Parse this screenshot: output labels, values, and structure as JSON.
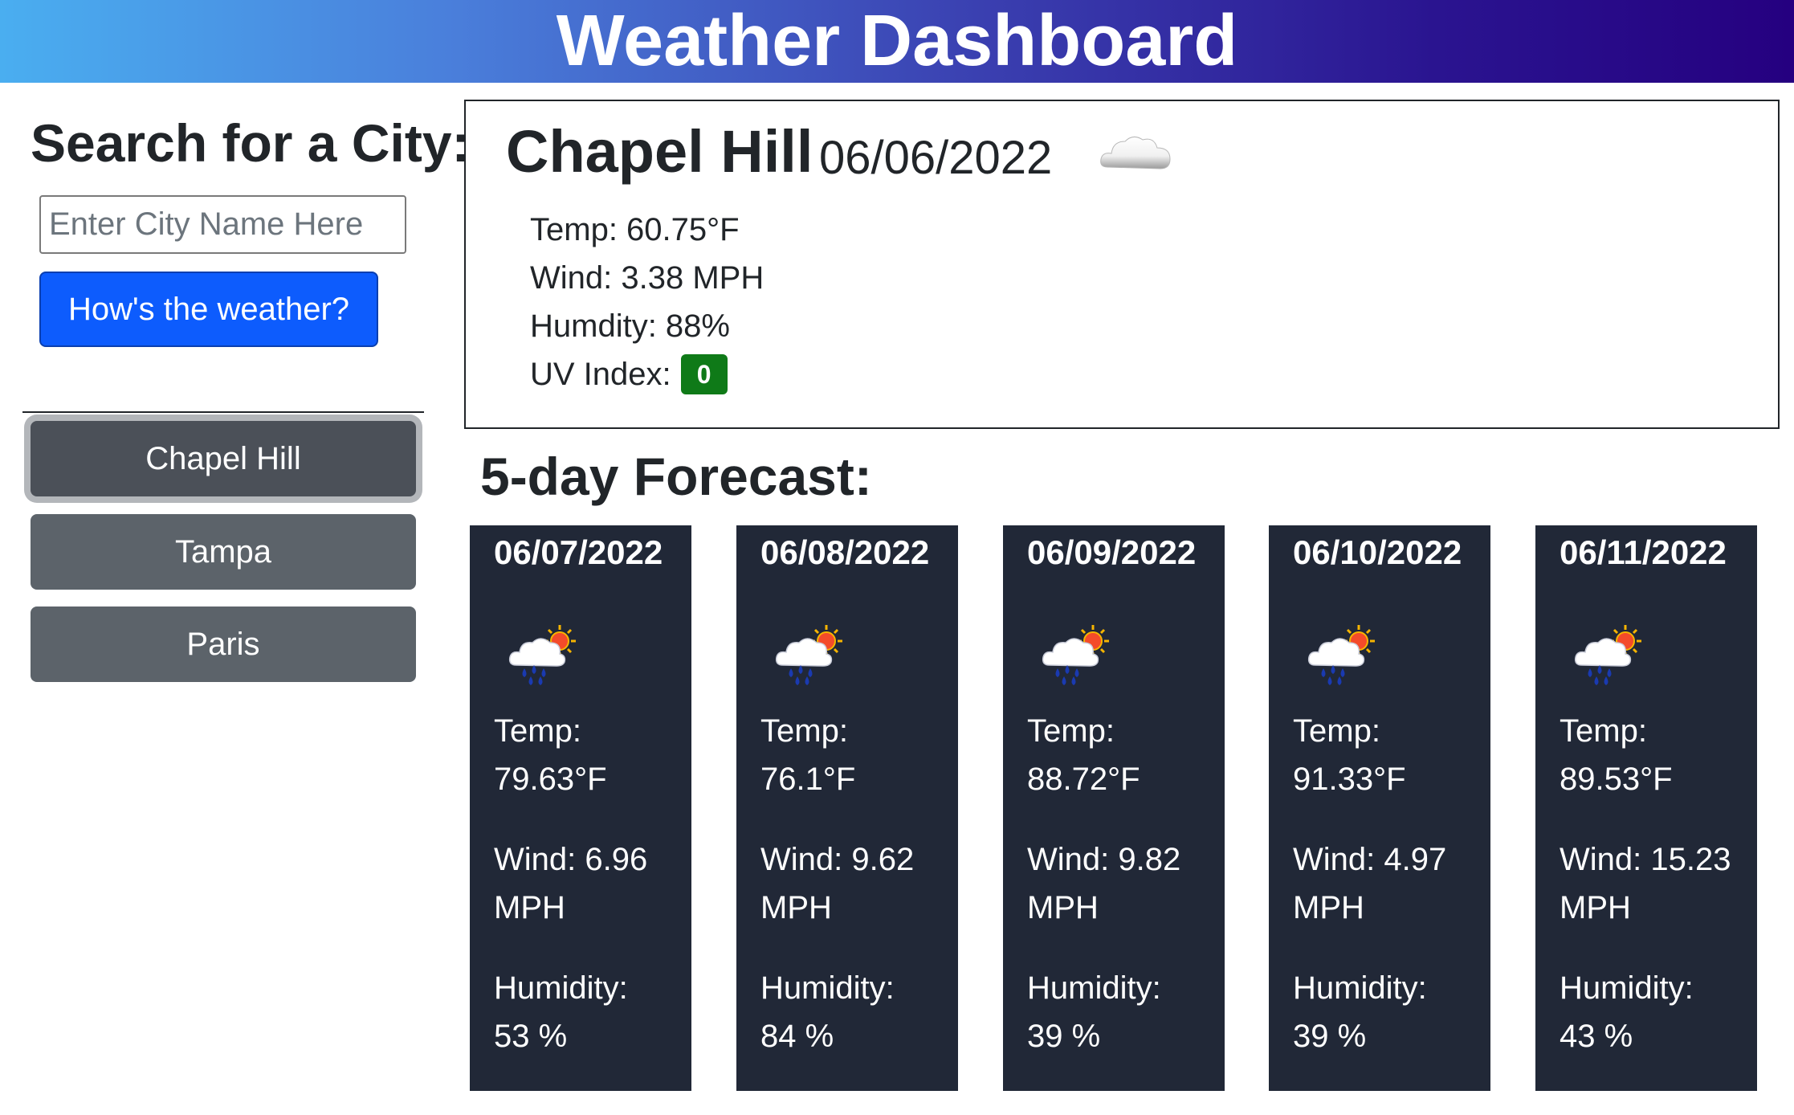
{
  "header": {
    "title": "Weather Dashboard"
  },
  "search": {
    "title": "Search for a City:",
    "placeholder": "Enter City Name Here",
    "button_label": "How's the weather?"
  },
  "history": [
    {
      "label": "Chapel Hill",
      "active": true
    },
    {
      "label": "Tampa",
      "active": false
    },
    {
      "label": "Paris",
      "active": false
    }
  ],
  "current": {
    "city": "Chapel Hill",
    "date": "06/06/2022",
    "icon": "cloud-icon",
    "temp": "Temp: 60.75°F",
    "wind": "Wind: 3.38 MPH",
    "humidity": "Humdity: 88%",
    "uv_label": "UV Index:",
    "uv_value": "0",
    "uv_color": "#0f7a18"
  },
  "forecast": {
    "title": "5-day Forecast:",
    "days": [
      {
        "date": "06/07/2022",
        "icon": "rain-sun-icon",
        "temp_label": "Temp:",
        "temp": "79.63°F",
        "wind": "Wind: 6.96 MPH",
        "humidity_label": "Humidity:",
        "humidity": "53 %"
      },
      {
        "date": "06/08/2022",
        "icon": "rain-sun-icon",
        "temp_label": "Temp:",
        "temp": "76.1°F",
        "wind": "Wind: 9.62 MPH",
        "humidity_label": "Humidity:",
        "humidity": "84 %"
      },
      {
        "date": "06/09/2022",
        "icon": "rain-sun-icon",
        "temp_label": "Temp:",
        "temp": "88.72°F",
        "wind": "Wind: 9.82 MPH",
        "humidity_label": "Humidity:",
        "humidity": "39 %"
      },
      {
        "date": "06/10/2022",
        "icon": "rain-sun-icon",
        "temp_label": "Temp:",
        "temp": "91.33°F",
        "wind": "Wind: 4.97 MPH",
        "humidity_label": "Humidity:",
        "humidity": "39 %"
      },
      {
        "date": "06/11/2022",
        "icon": "rain-sun-icon",
        "temp_label": "Temp:",
        "temp": "89.53°F",
        "wind": "Wind: 15.23 MPH",
        "humidity_label": "Humidity:",
        "humidity": "43 %"
      }
    ]
  },
  "colors": {
    "search_button": "#0d5cfd",
    "city_button": "#5c636a",
    "forecast_card": "#212837"
  }
}
